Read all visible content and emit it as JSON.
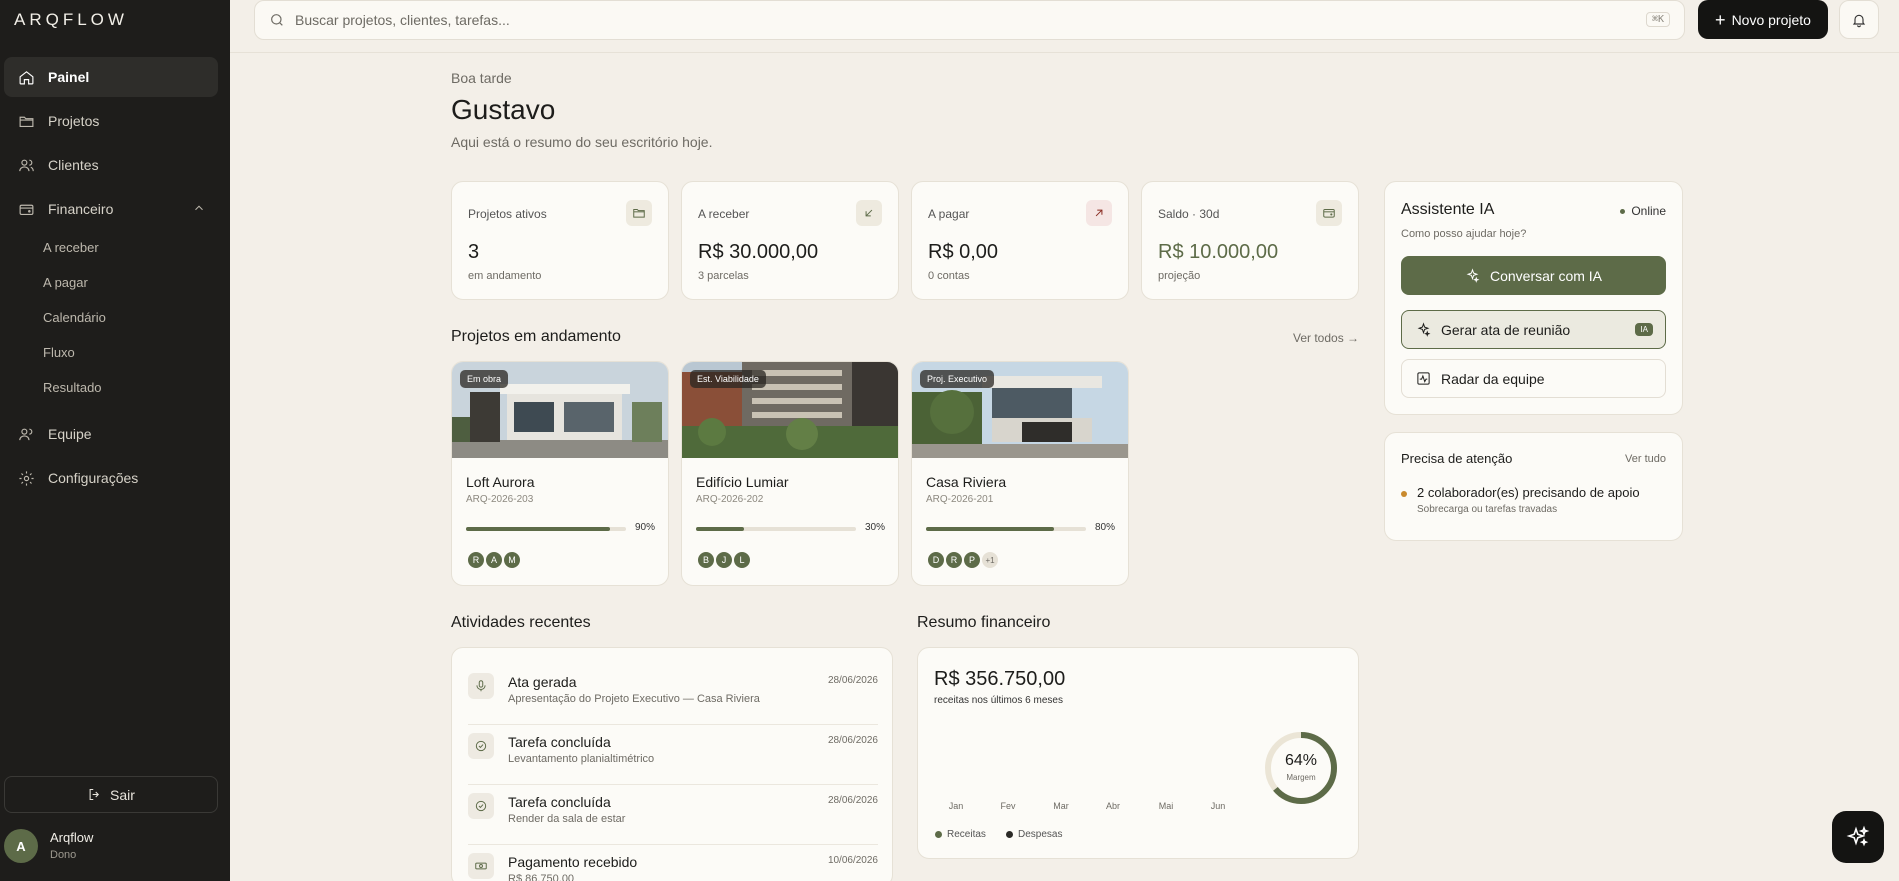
{
  "app": {
    "logo": "ARQFLOW"
  },
  "sidebar": {
    "items": [
      {
        "label": "Painel",
        "icon": "home-icon"
      },
      {
        "label": "Projetos",
        "icon": "folder-icon"
      },
      {
        "label": "Clientes",
        "icon": "users-icon"
      },
      {
        "label": "Financeiro",
        "icon": "wallet-icon"
      },
      {
        "label": "Equipe",
        "icon": "team-icon"
      },
      {
        "label": "Configurações",
        "icon": "gear-icon"
      }
    ],
    "financeiro_sub": [
      "A receber",
      "A pagar",
      "Calendário",
      "Fluxo",
      "Resultado"
    ],
    "logout": "Sair",
    "user": {
      "initial": "A",
      "name": "Arqflow",
      "role": "Dono"
    }
  },
  "topbar": {
    "search_placeholder": "Buscar projetos, clientes, tarefas...",
    "shortcut": "⌘K",
    "new_project": "Novo projeto"
  },
  "greeting": {
    "small": "Boa tarde",
    "name": "Gustavo",
    "subtitle": "Aqui está o resumo do seu escritório hoje."
  },
  "kpis": [
    {
      "label": "Projetos ativos",
      "value": "3",
      "sub": "em andamento",
      "icon": "folder-icon"
    },
    {
      "label": "A receber",
      "value": "R$ 30.000,00",
      "sub": "3 parcelas",
      "icon": "arrow-down-left-icon"
    },
    {
      "label": "A pagar",
      "value": "R$ 0,00",
      "sub": "0 contas",
      "icon": "arrow-up-right-icon"
    },
    {
      "label": "Saldo · 30d",
      "value": "R$ 10.000,00",
      "sub": "projeção",
      "icon": "wallet-icon"
    }
  ],
  "projects_section": {
    "title": "Projetos em andamento",
    "see_all": "Ver todos →"
  },
  "projects": [
    {
      "badge": "Em obra",
      "name": "Loft Aurora",
      "code": "ARQ-2026-203",
      "progress": 90,
      "progress_label": "90%",
      "avatars": [
        "R",
        "A",
        "M"
      ],
      "more": ""
    },
    {
      "badge": "Est. Viabilidade",
      "name": "Edifício Lumiar",
      "code": "ARQ-2026-202",
      "progress": 30,
      "progress_label": "30%",
      "avatars": [
        "B",
        "J",
        "L"
      ],
      "more": ""
    },
    {
      "badge": "Proj. Executivo",
      "name": "Casa Riviera",
      "code": "ARQ-2026-201",
      "progress": 80,
      "progress_label": "80%",
      "avatars": [
        "D",
        "R",
        "P"
      ],
      "more": "+1"
    }
  ],
  "activities_section": {
    "title": "Atividades recentes"
  },
  "activities": [
    {
      "title": "Ata gerada",
      "desc": "Apresentação do Projeto Executivo — Casa Riviera",
      "date": "28/06/2026",
      "icon": "microphone-icon"
    },
    {
      "title": "Tarefa concluída",
      "desc": "Levantamento planialtimétrico",
      "date": "28/06/2026",
      "icon": "check-circle-icon"
    },
    {
      "title": "Tarefa concluída",
      "desc": "Render da sala de estar",
      "date": "28/06/2026",
      "icon": "check-circle-icon"
    },
    {
      "title": "Pagamento recebido",
      "desc": "R$ 86.750,00",
      "date": "10/06/2026",
      "icon": "cash-icon"
    }
  ],
  "finance": {
    "title": "Resumo financeiro",
    "total": "R$ 356.750,00",
    "subtitle": "receitas nos últimos 6 meses",
    "months": [
      "Jan",
      "Fev",
      "Mar",
      "Abr",
      "Mai",
      "Jun"
    ],
    "legend": [
      "Receitas",
      "Despesas"
    ],
    "colors": {
      "receitas": "#5d6b48",
      "despesas": "#2b2a27"
    },
    "margin": 64,
    "margin_label": "64%",
    "margin_caption": "Margem"
  },
  "assistant": {
    "title": "Assistente IA",
    "status": "Online",
    "subtitle": "Como posso ajudar hoje?",
    "primary": "Conversar com IA",
    "meeting": "Gerar ata de reunião",
    "meeting_badge": "IA",
    "radar": "Radar da equipe"
  },
  "attention": {
    "title": "Precisa de atenção",
    "see_all": "Ver tudo",
    "item": "2 colaborador(es) precisando de apoio",
    "item_sub": "Sobrecarga ou tarefas travadas"
  },
  "colors": {
    "accent": "#5d6b48",
    "sidebar": "#1e1d1b",
    "background": "#f3efe8",
    "warning": "#c98a2d"
  }
}
